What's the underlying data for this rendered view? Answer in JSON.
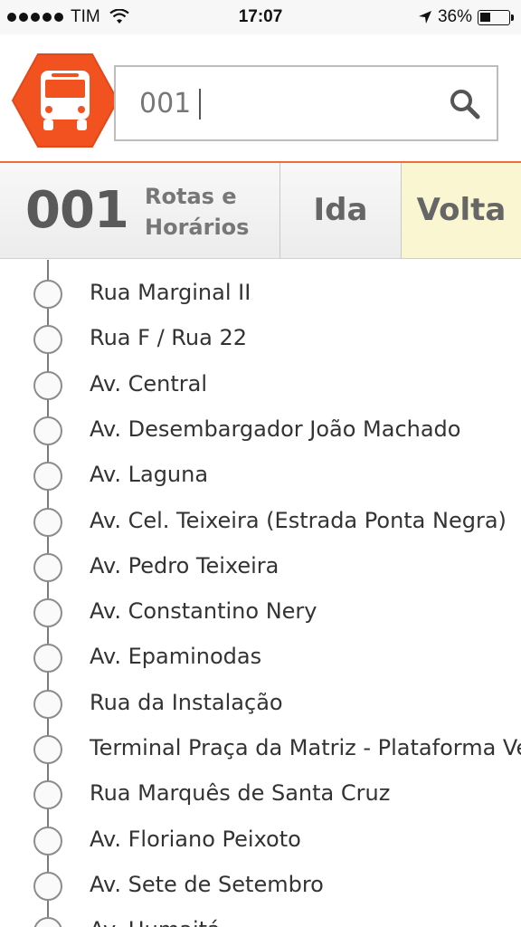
{
  "status_bar": {
    "carrier": "TIM",
    "time": "17:07",
    "battery": "36%",
    "battery_level": 0.36
  },
  "search": {
    "value": "001",
    "placeholder": ""
  },
  "tabs": {
    "route_number": "001",
    "route_desc_line1": "Rotas e",
    "route_desc_line2": "Horários",
    "ida": "Ida",
    "volta": "Volta",
    "selected": "Volta"
  },
  "colors": {
    "brand_orange": "#f26b3a",
    "selected_tab": "#fbf6d2"
  },
  "stops": [
    "Rua Marginal II",
    "Rua F / Rua 22",
    "Av. Central",
    "Av. Desembargador João Machado",
    "Av. Laguna",
    "Av. Cel. Teixeira (Estrada Ponta Negra)",
    "Av. Pedro Teixeira",
    "Av. Constantino Nery",
    "Av. Epaminodas",
    "Rua da Instalação",
    "Terminal Praça da Matriz - Plataforma Ve",
    "Rua Marquês de Santa Cruz",
    "Av. Floriano Peixoto",
    "Av. Sete de Setembro",
    "Av. Humaitá"
  ]
}
